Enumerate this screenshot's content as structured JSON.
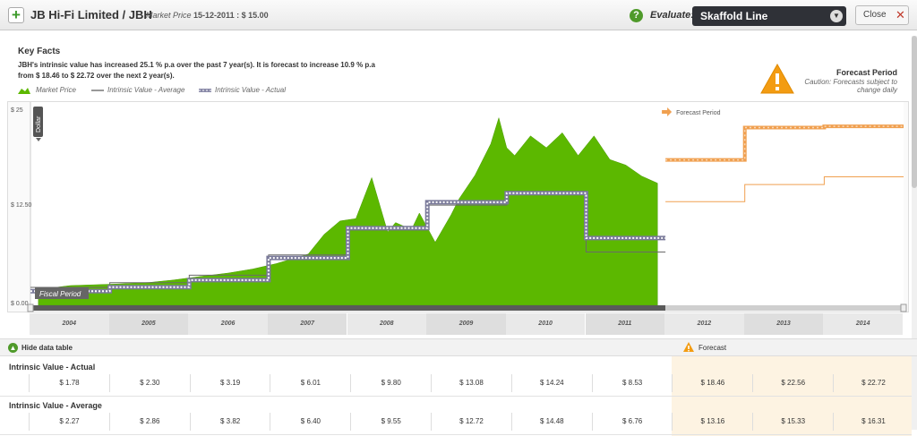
{
  "header": {
    "title": "JB Hi-Fi Limited / JBH",
    "market_price_label": "Market Price",
    "market_price_value": "15-12-2011 : $ 15.00",
    "evaluate_label": "Evaluate:",
    "evaluate_value": "Skaffold Line",
    "close_label": "Close"
  },
  "key_facts": {
    "title": "Key Facts",
    "text": "JBH's intrinsic value has increased 25.1 % p.a over the past 7 year(s). It is forecast to increase 10.9 % p.a from $ 18.46 to $ 22.72 over the next 2 year(s)."
  },
  "legend": {
    "market_price": "Market Price",
    "iv_average": "Intrinsic Value - Average",
    "iv_actual": "Intrinsic Value - Actual"
  },
  "forecast_notice": {
    "title": "Forecast Period",
    "caution": "Caution: Forecasts subject to change daily"
  },
  "chart": {
    "axis_toggle": "Dollar",
    "fiscal_period_label": "Fiscal Period",
    "forecast_period_label": "Forecast Period"
  },
  "table": {
    "hide_label": "Hide data table",
    "forecast_label": "Forecast",
    "rows": [
      {
        "title": "Intrinsic Value - Actual",
        "values": [
          "$ 1.78",
          "$ 2.30",
          "$ 3.19",
          "$ 6.01",
          "$ 9.80",
          "$ 13.08",
          "$ 14.24",
          "$ 8.53",
          "$ 18.46",
          "$ 22.56",
          "$ 22.72"
        ]
      },
      {
        "title": "Intrinsic Value - Average",
        "values": [
          "$ 2.27",
          "$ 2.86",
          "$ 3.82",
          "$ 6.40",
          "$ 9.55",
          "$ 12.72",
          "$ 14.48",
          "$ 6.76",
          "$ 13.16",
          "$ 15.33",
          "$ 16.31"
        ]
      }
    ]
  },
  "colors": {
    "market_price": "#5cb800",
    "forecast": "#f0a050",
    "actual_line": "#7a7a9a",
    "average_line": "#6a6a6a",
    "forecast_bg": "#fdf3e2"
  },
  "chart_data": {
    "type": "area",
    "title": "",
    "xlabel": "Fiscal Period",
    "ylabel": "Dollar",
    "y_ticks": [
      "$ 0.00",
      "$ 12.50",
      "$ 25"
    ],
    "ylim": [
      0,
      25
    ],
    "categories": [
      "2004",
      "2005",
      "2006",
      "2007",
      "2008",
      "2009",
      "2010",
      "2011",
      "2012",
      "2013",
      "2014"
    ],
    "forecast_categories": [
      "2012",
      "2013",
      "2014"
    ],
    "series": [
      {
        "name": "Intrinsic Value - Actual",
        "values": [
          1.78,
          2.3,
          3.19,
          6.01,
          9.8,
          13.08,
          14.24,
          8.53,
          18.46,
          22.56,
          22.72
        ]
      },
      {
        "name": "Intrinsic Value - Average",
        "values": [
          2.27,
          2.86,
          3.82,
          6.4,
          9.55,
          12.72,
          14.48,
          6.76,
          13.16,
          15.33,
          16.31
        ]
      },
      {
        "name": "Market Price",
        "x": [
          2003.6,
          2004.0,
          2004.3,
          2004.6,
          2005.0,
          2005.3,
          2005.6,
          2006.0,
          2006.3,
          2006.6,
          2007.0,
          2007.2,
          2007.4,
          2007.6,
          2007.8,
          2008.0,
          2008.1,
          2008.3,
          2008.4,
          2008.6,
          2008.8,
          2008.9,
          2009.0,
          2009.1,
          2009.3,
          2009.4,
          2009.5,
          2009.6,
          2009.8,
          2010.0,
          2010.2,
          2010.4,
          2010.6,
          2010.8,
          2011.0,
          2011.2,
          2011.4
        ],
        "values": [
          2.0,
          2.5,
          2.6,
          2.7,
          2.9,
          3.2,
          3.6,
          4.1,
          4.6,
          5.3,
          6.5,
          9.0,
          10.7,
          11.0,
          16.2,
          9.3,
          10.5,
          9.6,
          11.7,
          8.0,
          11.5,
          13.5,
          15.0,
          16.5,
          20.5,
          23.8,
          20.0,
          19.0,
          21.5,
          20.0,
          21.9,
          19.0,
          21.5,
          18.5,
          17.8,
          16.4,
          15.5
        ]
      }
    ]
  }
}
